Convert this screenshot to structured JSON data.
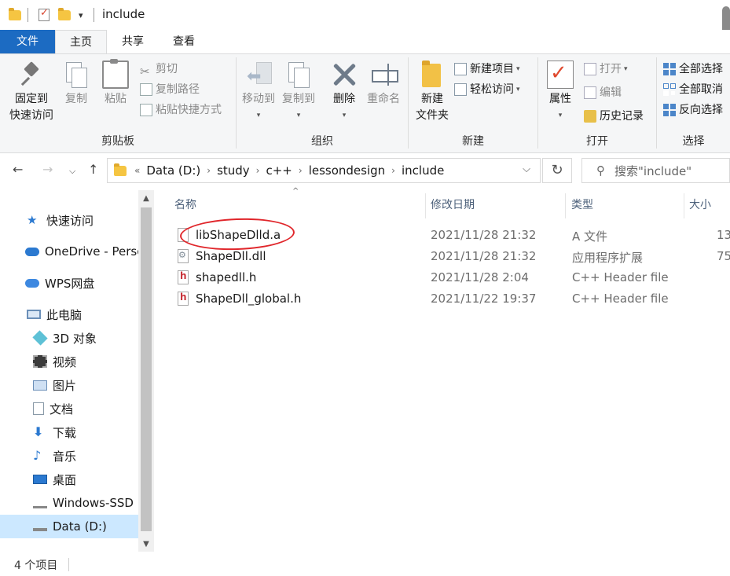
{
  "window": {
    "title": "include",
    "qat_dropdown": "▾"
  },
  "tabs": {
    "file": "文件",
    "home": "主页",
    "share": "共享",
    "view": "查看"
  },
  "ribbon": {
    "clipboard": {
      "label": "剪贴板",
      "pin_line1": "固定到",
      "pin_line2": "快速访问",
      "copy": "复制",
      "paste": "粘贴",
      "cut": "剪切",
      "copy_path": "复制路径",
      "paste_shortcut": "粘贴快捷方式"
    },
    "organize": {
      "label": "组织",
      "move_to": "移动到",
      "copy_to": "复制到",
      "delete": "删除",
      "rename": "重命名"
    },
    "new": {
      "label": "新建",
      "new_folder_line1": "新建",
      "new_folder_line2": "文件夹",
      "new_item": "新建项目",
      "easy_access": "轻松访问"
    },
    "open": {
      "label": "打开",
      "properties": "属性",
      "open": "打开",
      "edit": "编辑",
      "history": "历史记录"
    },
    "select": {
      "label": "选择",
      "select_all": "全部选择",
      "select_none": "全部取消",
      "invert": "反向选择"
    }
  },
  "address": {
    "overflow": "«",
    "crumbs": [
      "Data (D:)",
      "study",
      "c++",
      "lessondesign",
      "include"
    ],
    "search_placeholder": "搜索\"include\""
  },
  "navpane": {
    "items": [
      {
        "label": "快速访问"
      },
      {
        "label": "OneDrive - Personal"
      },
      {
        "label": "WPS网盘"
      },
      {
        "label": "此电脑"
      },
      {
        "label": "3D 对象"
      },
      {
        "label": "视频"
      },
      {
        "label": "图片"
      },
      {
        "label": "文档"
      },
      {
        "label": "下载"
      },
      {
        "label": "音乐"
      },
      {
        "label": "桌面"
      },
      {
        "label": "Windows-SSD (C:)"
      },
      {
        "label": "Data (D:)"
      }
    ]
  },
  "filelist": {
    "columns": {
      "name": "名称",
      "date": "修改日期",
      "type": "类型",
      "size": "大小"
    },
    "rows": [
      {
        "name": "libShapeDlld.a",
        "date": "2021/11/28 21:32",
        "type": "A 文件",
        "size": "13"
      },
      {
        "name": "ShapeDll.dll",
        "date": "2021/11/28 21:32",
        "type": "应用程序扩展",
        "size": "75"
      },
      {
        "name": "shapedll.h",
        "date": "2021/11/28 2:04",
        "type": "C++ Header file",
        "size": ""
      },
      {
        "name": "ShapeDll_global.h",
        "date": "2021/11/22 19:37",
        "type": "C++ Header file",
        "size": ""
      }
    ]
  },
  "status": {
    "count": "4 个项目"
  },
  "colors": {
    "file_tab": "#1c6bc2",
    "selection": "#cce8ff",
    "annotation": "#e0262b"
  }
}
